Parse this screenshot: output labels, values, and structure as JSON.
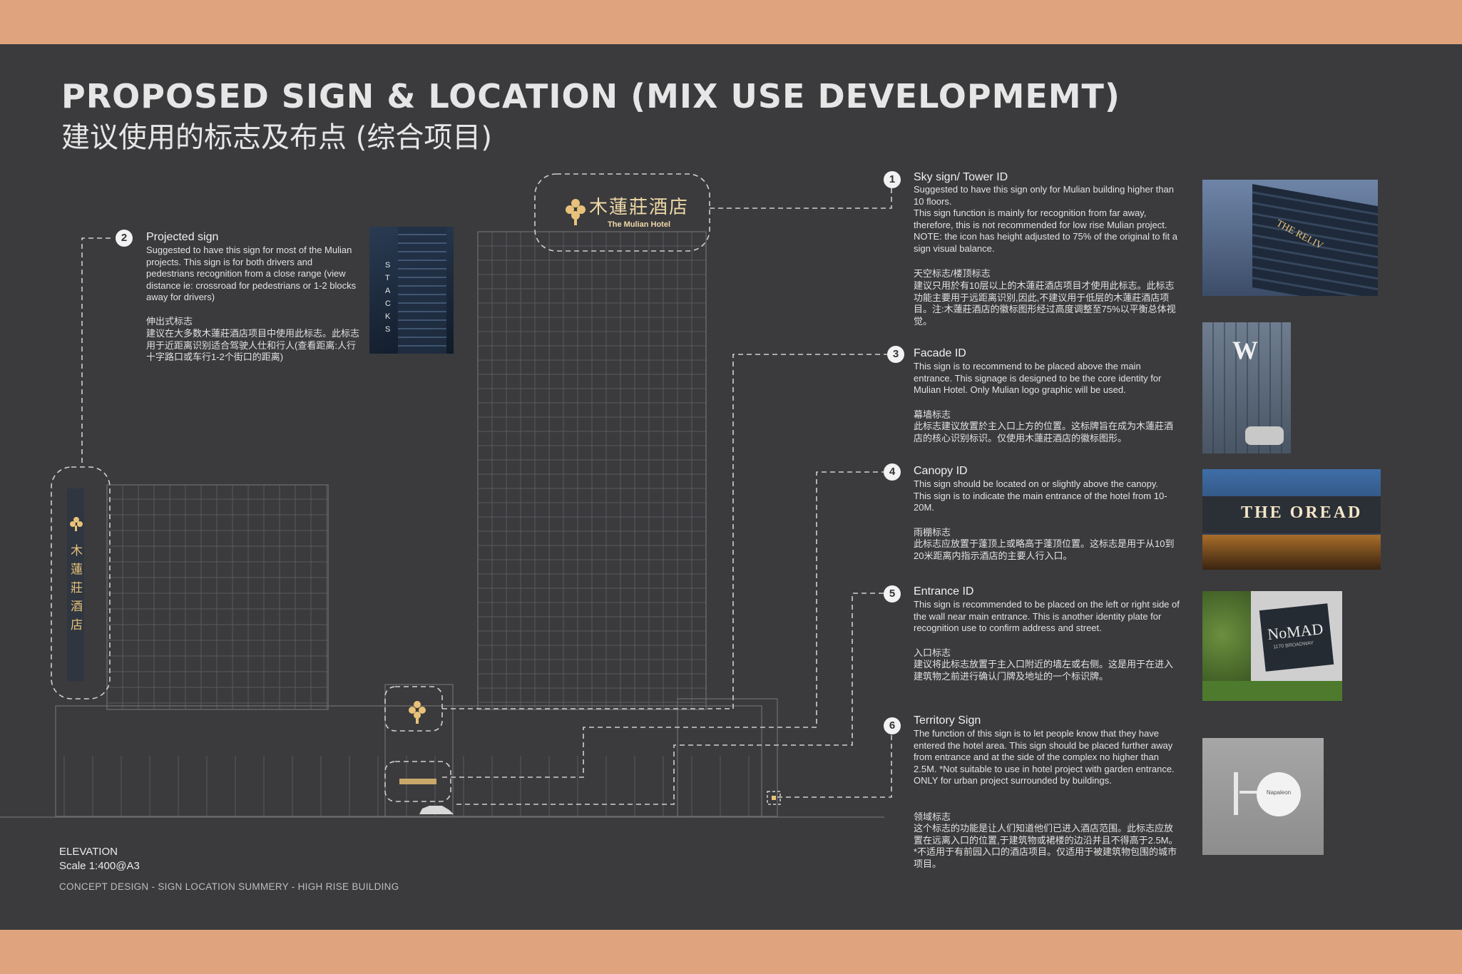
{
  "header": {
    "title_en": "PROPOSED SIGN & LOCATION (MIX USE DEVELOPMEMT)",
    "title_zh": "建议使用的标志及布点 (综合项目)"
  },
  "hotel_logo": {
    "name_zh": "木蓮莊酒店",
    "name_en": "The Mulian Hotel"
  },
  "sections": [
    {
      "number": "1",
      "title": "Sky sign/ Tower ID",
      "body_en": "Suggested to have this sign only for Mulian building higher than 10 floors.\nThis sign function is mainly for recognition from far away, therefore, this is not recommended for low rise Mulian project. NOTE: the icon has height adjusted to 75% of the original to fit a sign visual balance.",
      "title_zh": "天空标志/楼顶标志",
      "body_zh": "建议只用於有10层以上的木蓮莊酒店项目才使用此标志。此标志功能主要用于远距离识别,因此,不建议用于低层的木蓮莊酒店项目。注:木蓮莊酒店的徽标图形经过高度调整至75%以平衡总体视觉。"
    },
    {
      "number": "2",
      "title": "Projected sign",
      "body_en": "Suggested to have this sign for most of the Mulian projects. This sign is for both drivers and pedestrians recognition from a close range (view distance ie: crossroad for pedestrians or 1-2 blocks away for drivers)",
      "title_zh": "伸出式标志",
      "body_zh": "建议在大多数木蓮莊酒店项目中使用此标志。此标志用于近距离识别适合驾驶人仕和行人(查看距离:人行十字路口或车行1-2个街口的距离)"
    },
    {
      "number": "3",
      "title": "Facade ID",
      "body_en": "This sign is to recommend to be placed above the main entrance. This signage is designed to be the core identity for Mulian Hotel. Only Mulian logo graphic will be used.",
      "title_zh": "幕墙标志",
      "body_zh": "此标志建议放置於主入口上方的位置。这标牌旨在成为木蓮莊酒店的核心识别标识。仅使用木蓮莊酒店的徽标图形。"
    },
    {
      "number": "4",
      "title": "Canopy ID",
      "body_en": "This sign should be located on or slightly above the canopy. This sign is to indicate the main entrance of the hotel from 10-20M.",
      "title_zh": "雨棚标志",
      "body_zh": "此标志应放置于蓬顶上或略高于蓬顶位置。这标志是用于从10到20米距离内指示酒店的主要人行入口。"
    },
    {
      "number": "5",
      "title": "Entrance ID",
      "body_en": "This sign is recommended to be placed on the left or right side of the wall near main entrance. This is another identity plate for recognition use to confirm address and street.",
      "title_zh": "入口标志",
      "body_zh": "建议将此标志放置于主入口附近的墙左或右侧。这是用于在进入建筑物之前进行确认门牌及地址的一个标识牌。"
    },
    {
      "number": "6",
      "title": "Territory Sign",
      "body_en": "The function of this sign is to let people know that they have entered the hotel area. This sign should be placed further away from entrance and at the side of the complex no higher than 2.5M. *Not suitable to use in hotel project with garden entrance. ONLY for urban project surrounded by buildings.",
      "title_zh": "领域标志",
      "body_zh": "这个标志的功能是让人们知道他们已进入酒店范围。此标志应放置在远离入口的位置,于建筑物或裙楼的边沿并且不得高于2.5M。*不适用于有前园入口的酒店项目。仅适用于被建筑物包围的城市项目。"
    }
  ],
  "photos": {
    "stacks_text": "S T A C K S",
    "tower_sign_text": "THE RELIV",
    "facade_letter": "W",
    "canopy_text": "THE OREAD",
    "entrance_text": "NoMAD",
    "entrance_sub": "1170 BROADWAY",
    "territory_text": "Napaleon"
  },
  "footer": {
    "label": "ELEVATION",
    "scale": "Scale 1:400@A3",
    "concept": "CONCEPT DESIGN - SIGN LOCATION SUMMERY - HIGH RISE BUILDING"
  },
  "colors": {
    "background": "#3b3b3d",
    "accent_band": "#dfa47d",
    "gold": "#e8c27a",
    "line": "#cfcfcf"
  }
}
